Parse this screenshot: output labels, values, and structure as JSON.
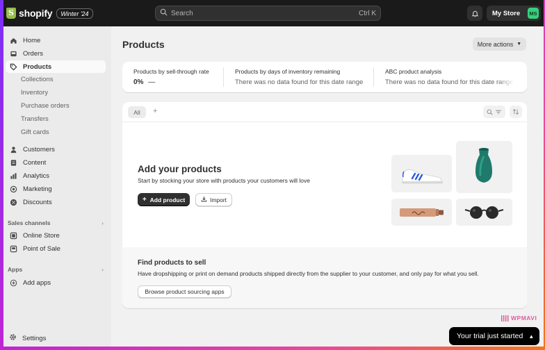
{
  "topbar": {
    "brand": "shopify",
    "edition_badge": "Winter '24",
    "search_placeholder": "Search",
    "search_shortcut": "Ctrl K",
    "store_name": "My Store",
    "store_initials": "MS"
  },
  "sidebar": {
    "items": [
      {
        "label": "Home",
        "icon": "home-icon"
      },
      {
        "label": "Orders",
        "icon": "inbox-icon"
      },
      {
        "label": "Products",
        "icon": "tag-icon",
        "active": true
      },
      {
        "label": "Customers",
        "icon": "person-icon"
      },
      {
        "label": "Content",
        "icon": "document-icon"
      },
      {
        "label": "Analytics",
        "icon": "bar-chart-icon"
      },
      {
        "label": "Marketing",
        "icon": "target-icon"
      },
      {
        "label": "Discounts",
        "icon": "discount-icon"
      }
    ],
    "product_subitems": [
      "Collections",
      "Inventory",
      "Purchase orders",
      "Transfers",
      "Gift cards"
    ],
    "sales_channels_heading": "Sales channels",
    "sales_channels": [
      {
        "label": "Online Store",
        "icon": "store-icon"
      },
      {
        "label": "Point of Sale",
        "icon": "pos-icon"
      }
    ],
    "apps_heading": "Apps",
    "add_apps": "Add apps",
    "settings": "Settings"
  },
  "main": {
    "title": "Products",
    "more_actions": "More actions",
    "stats": [
      {
        "label": "Products by sell-through rate",
        "value": "0%",
        "trend": "—"
      },
      {
        "label": "Products by days of inventory remaining",
        "value": "There was no data found for this date range"
      },
      {
        "label": "ABC product analysis",
        "value": "There was no data found for this date range"
      }
    ],
    "tabs": {
      "all": "All",
      "add": "+"
    },
    "empty_state": {
      "heading": "Add your products",
      "text": "Start by stocking your store with products your customers will love",
      "add_button": "Add product",
      "import_button": "Import"
    },
    "find": {
      "heading": "Find products to sell",
      "text": "Have dropshipping or print on demand products shipped directly from the supplier to your customer, and only pay for what you sell.",
      "button": "Browse product sourcing apps"
    }
  },
  "watermark": "WPMAVI",
  "trial_banner": "Your trial just started",
  "colors": {
    "topbar": "#1a1a1a",
    "accent_green": "#95bf47",
    "avatar_green": "#36d07c",
    "primary_button": "#303030"
  }
}
